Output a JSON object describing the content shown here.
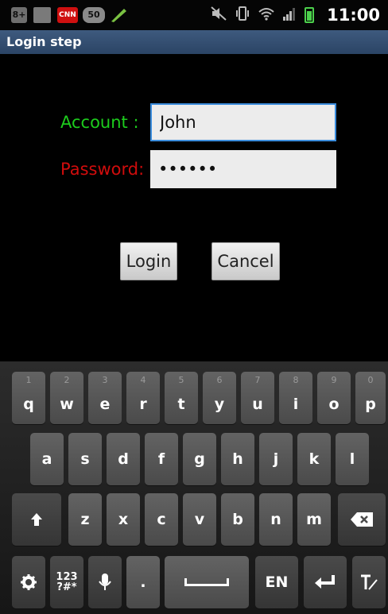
{
  "status_bar": {
    "icons": [
      "google-plus-icon",
      "messages-icon",
      "cnn-icon",
      "50-badge-icon",
      "pen-icon",
      "mute-icon",
      "vibrate-icon",
      "wifi-icon",
      "signal-icon",
      "battery-icon"
    ],
    "cnn_label": "CNN",
    "badge_label": "50",
    "gplus_label": "8+",
    "time": "11:00"
  },
  "title_bar": {
    "title": "Login step"
  },
  "form": {
    "account_label": "Account :",
    "account_value": "John",
    "password_label": "Password:",
    "password_value": "••••••",
    "login_button": "Login",
    "cancel_button": "Cancel"
  },
  "colors": {
    "account_label": "#1dcc1d",
    "password_label": "#d00c0c",
    "title_bar": "#2b4465",
    "focus_border": "#3a8cdc"
  },
  "keyboard": {
    "row1": [
      {
        "label": "q",
        "num": "1"
      },
      {
        "label": "w",
        "num": "2"
      },
      {
        "label": "e",
        "num": "3"
      },
      {
        "label": "r",
        "num": "4"
      },
      {
        "label": "t",
        "num": "5"
      },
      {
        "label": "y",
        "num": "6"
      },
      {
        "label": "u",
        "num": "7"
      },
      {
        "label": "i",
        "num": "8"
      },
      {
        "label": "o",
        "num": "9"
      },
      {
        "label": "p",
        "num": "0"
      }
    ],
    "row2": [
      "a",
      "s",
      "d",
      "f",
      "g",
      "h",
      "j",
      "k",
      "l"
    ],
    "row3": [
      "z",
      "x",
      "c",
      "v",
      "b",
      "n",
      "m"
    ],
    "symbols_label_top": "123",
    "symbols_label_bottom": "?#*",
    "period": ".",
    "language": "EN"
  }
}
